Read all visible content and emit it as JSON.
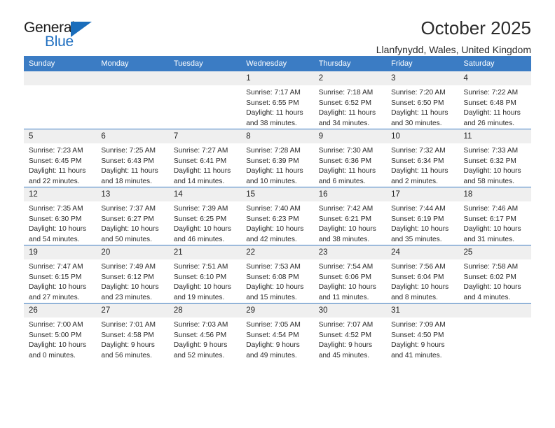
{
  "brand": {
    "name_top": "General",
    "name_bottom": "Blue",
    "flag_icon": "triangle-flag-icon",
    "color_dark": "#1d1d1d",
    "color_blue": "#1f6fc0"
  },
  "header": {
    "title": "October 2025",
    "subtitle": "Llanfynydd, Wales, United Kingdom"
  },
  "theme": {
    "header_row_bg": "#3b7cc4",
    "daynum_bg": "#efefef",
    "row_border": "#3b7cc4",
    "text": "#222222"
  },
  "calendar": {
    "weekday_headers": [
      "Sunday",
      "Monday",
      "Tuesday",
      "Wednesday",
      "Thursday",
      "Friday",
      "Saturday"
    ],
    "labels": {
      "sunrise": "Sunrise:",
      "sunset": "Sunset:",
      "daylight": "Daylight:"
    },
    "weeks": [
      [
        {
          "day": "",
          "empty": true
        },
        {
          "day": "",
          "empty": true
        },
        {
          "day": "",
          "empty": true
        },
        {
          "day": "1",
          "sunrise": "Sunrise: 7:17 AM",
          "sunset": "Sunset: 6:55 PM",
          "daylight": "Daylight: 11 hours and 38 minutes."
        },
        {
          "day": "2",
          "sunrise": "Sunrise: 7:18 AM",
          "sunset": "Sunset: 6:52 PM",
          "daylight": "Daylight: 11 hours and 34 minutes."
        },
        {
          "day": "3",
          "sunrise": "Sunrise: 7:20 AM",
          "sunset": "Sunset: 6:50 PM",
          "daylight": "Daylight: 11 hours and 30 minutes."
        },
        {
          "day": "4",
          "sunrise": "Sunrise: 7:22 AM",
          "sunset": "Sunset: 6:48 PM",
          "daylight": "Daylight: 11 hours and 26 minutes."
        }
      ],
      [
        {
          "day": "5",
          "sunrise": "Sunrise: 7:23 AM",
          "sunset": "Sunset: 6:45 PM",
          "daylight": "Daylight: 11 hours and 22 minutes."
        },
        {
          "day": "6",
          "sunrise": "Sunrise: 7:25 AM",
          "sunset": "Sunset: 6:43 PM",
          "daylight": "Daylight: 11 hours and 18 minutes."
        },
        {
          "day": "7",
          "sunrise": "Sunrise: 7:27 AM",
          "sunset": "Sunset: 6:41 PM",
          "daylight": "Daylight: 11 hours and 14 minutes."
        },
        {
          "day": "8",
          "sunrise": "Sunrise: 7:28 AM",
          "sunset": "Sunset: 6:39 PM",
          "daylight": "Daylight: 11 hours and 10 minutes."
        },
        {
          "day": "9",
          "sunrise": "Sunrise: 7:30 AM",
          "sunset": "Sunset: 6:36 PM",
          "daylight": "Daylight: 11 hours and 6 minutes."
        },
        {
          "day": "10",
          "sunrise": "Sunrise: 7:32 AM",
          "sunset": "Sunset: 6:34 PM",
          "daylight": "Daylight: 11 hours and 2 minutes."
        },
        {
          "day": "11",
          "sunrise": "Sunrise: 7:33 AM",
          "sunset": "Sunset: 6:32 PM",
          "daylight": "Daylight: 10 hours and 58 minutes."
        }
      ],
      [
        {
          "day": "12",
          "sunrise": "Sunrise: 7:35 AM",
          "sunset": "Sunset: 6:30 PM",
          "daylight": "Daylight: 10 hours and 54 minutes."
        },
        {
          "day": "13",
          "sunrise": "Sunrise: 7:37 AM",
          "sunset": "Sunset: 6:27 PM",
          "daylight": "Daylight: 10 hours and 50 minutes."
        },
        {
          "day": "14",
          "sunrise": "Sunrise: 7:39 AM",
          "sunset": "Sunset: 6:25 PM",
          "daylight": "Daylight: 10 hours and 46 minutes."
        },
        {
          "day": "15",
          "sunrise": "Sunrise: 7:40 AM",
          "sunset": "Sunset: 6:23 PM",
          "daylight": "Daylight: 10 hours and 42 minutes."
        },
        {
          "day": "16",
          "sunrise": "Sunrise: 7:42 AM",
          "sunset": "Sunset: 6:21 PM",
          "daylight": "Daylight: 10 hours and 38 minutes."
        },
        {
          "day": "17",
          "sunrise": "Sunrise: 7:44 AM",
          "sunset": "Sunset: 6:19 PM",
          "daylight": "Daylight: 10 hours and 35 minutes."
        },
        {
          "day": "18",
          "sunrise": "Sunrise: 7:46 AM",
          "sunset": "Sunset: 6:17 PM",
          "daylight": "Daylight: 10 hours and 31 minutes."
        }
      ],
      [
        {
          "day": "19",
          "sunrise": "Sunrise: 7:47 AM",
          "sunset": "Sunset: 6:15 PM",
          "daylight": "Daylight: 10 hours and 27 minutes."
        },
        {
          "day": "20",
          "sunrise": "Sunrise: 7:49 AM",
          "sunset": "Sunset: 6:12 PM",
          "daylight": "Daylight: 10 hours and 23 minutes."
        },
        {
          "day": "21",
          "sunrise": "Sunrise: 7:51 AM",
          "sunset": "Sunset: 6:10 PM",
          "daylight": "Daylight: 10 hours and 19 minutes."
        },
        {
          "day": "22",
          "sunrise": "Sunrise: 7:53 AM",
          "sunset": "Sunset: 6:08 PM",
          "daylight": "Daylight: 10 hours and 15 minutes."
        },
        {
          "day": "23",
          "sunrise": "Sunrise: 7:54 AM",
          "sunset": "Sunset: 6:06 PM",
          "daylight": "Daylight: 10 hours and 11 minutes."
        },
        {
          "day": "24",
          "sunrise": "Sunrise: 7:56 AM",
          "sunset": "Sunset: 6:04 PM",
          "daylight": "Daylight: 10 hours and 8 minutes."
        },
        {
          "day": "25",
          "sunrise": "Sunrise: 7:58 AM",
          "sunset": "Sunset: 6:02 PM",
          "daylight": "Daylight: 10 hours and 4 minutes."
        }
      ],
      [
        {
          "day": "26",
          "sunrise": "Sunrise: 7:00 AM",
          "sunset": "Sunset: 5:00 PM",
          "daylight": "Daylight: 10 hours and 0 minutes."
        },
        {
          "day": "27",
          "sunrise": "Sunrise: 7:01 AM",
          "sunset": "Sunset: 4:58 PM",
          "daylight": "Daylight: 9 hours and 56 minutes."
        },
        {
          "day": "28",
          "sunrise": "Sunrise: 7:03 AM",
          "sunset": "Sunset: 4:56 PM",
          "daylight": "Daylight: 9 hours and 52 minutes."
        },
        {
          "day": "29",
          "sunrise": "Sunrise: 7:05 AM",
          "sunset": "Sunset: 4:54 PM",
          "daylight": "Daylight: 9 hours and 49 minutes."
        },
        {
          "day": "30",
          "sunrise": "Sunrise: 7:07 AM",
          "sunset": "Sunset: 4:52 PM",
          "daylight": "Daylight: 9 hours and 45 minutes."
        },
        {
          "day": "31",
          "sunrise": "Sunrise: 7:09 AM",
          "sunset": "Sunset: 4:50 PM",
          "daylight": "Daylight: 9 hours and 41 minutes."
        },
        {
          "day": "",
          "empty": true
        }
      ]
    ]
  }
}
